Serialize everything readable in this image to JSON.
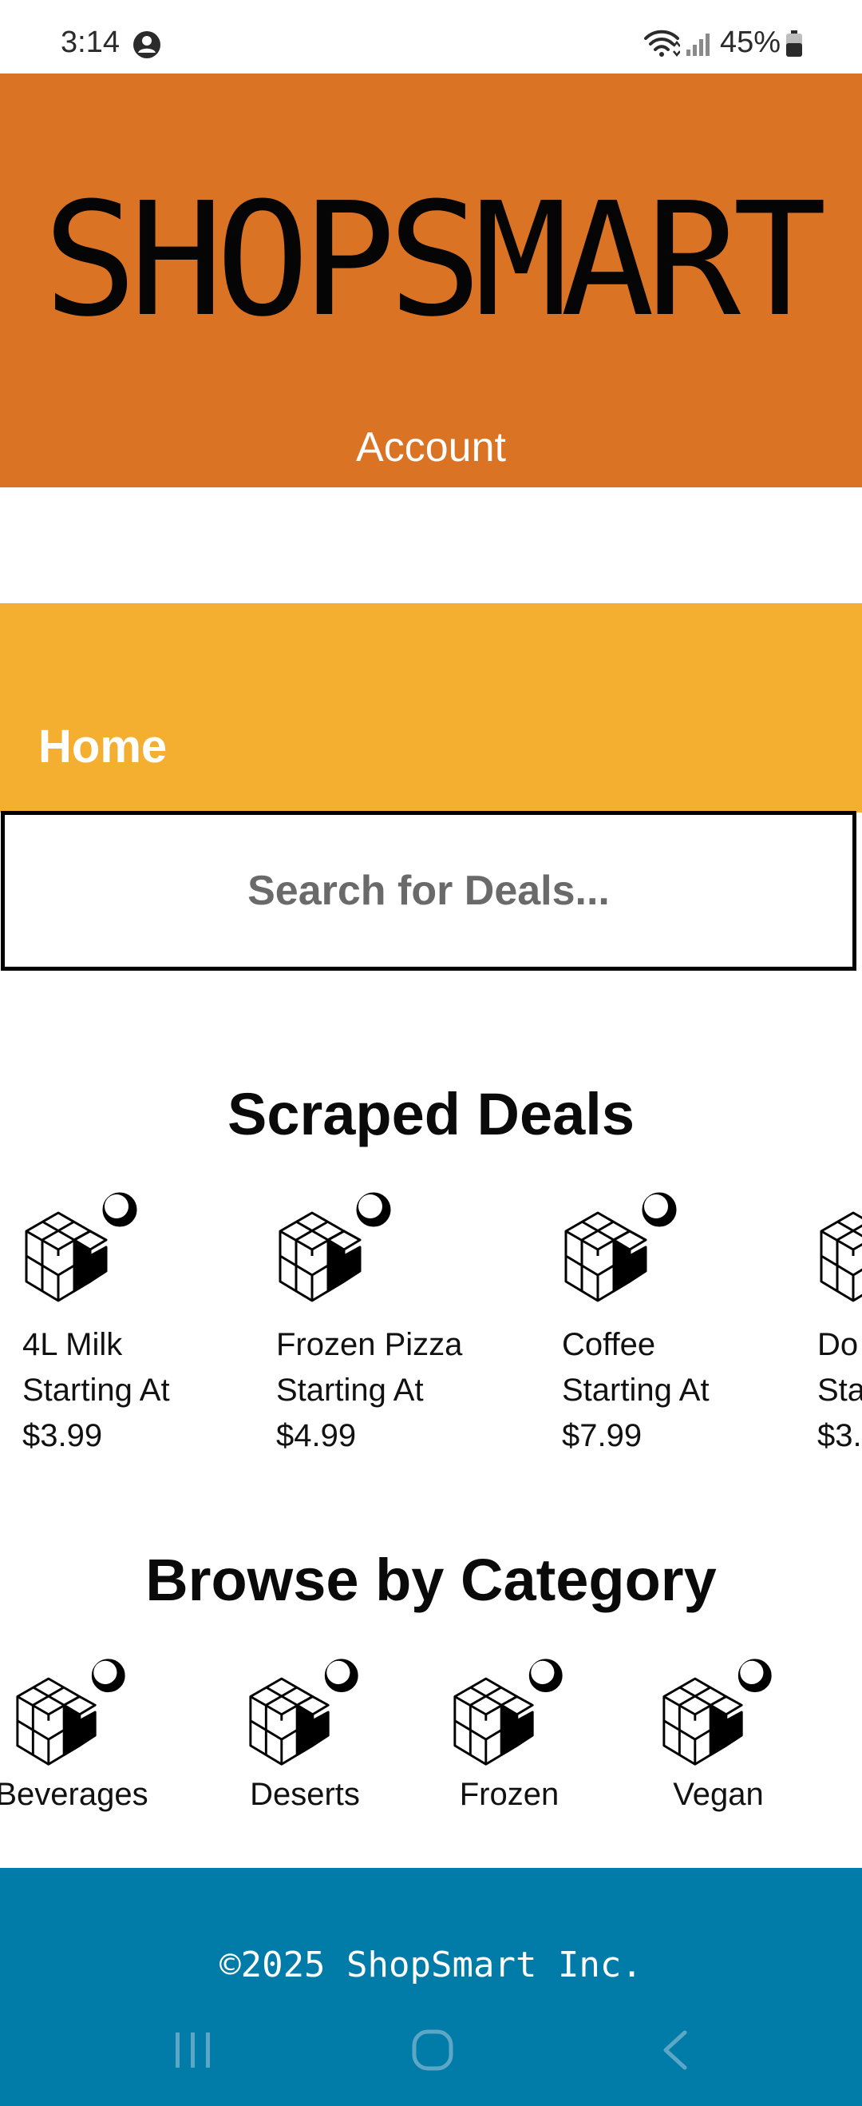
{
  "status_bar": {
    "time": "3:14",
    "battery_percent": "45%",
    "account_icon": "account-circle-icon",
    "wifi_icon": "wifi-icon",
    "signal_icon": "cell-signal-icon",
    "battery_icon": "battery-icon"
  },
  "header": {
    "brand": "SHOPSMART",
    "account_label": "Account",
    "background_color": "#db7324"
  },
  "nav": {
    "home_label": "Home",
    "background_color": "#f4ae30"
  },
  "search": {
    "placeholder": "Search for Deals..."
  },
  "deals_section": {
    "title": "Scraped Deals",
    "items": [
      {
        "name": "4L Milk",
        "prefix": "Starting At",
        "price": "$3.99",
        "icon": "product-cube-icon"
      },
      {
        "name": "Frozen Pizza",
        "prefix": "Starting At",
        "price": "$4.99",
        "icon": "product-cube-icon"
      },
      {
        "name": "Coffee",
        "prefix": "Starting At",
        "price": "$7.99",
        "icon": "product-cube-icon"
      },
      {
        "name": "Do",
        "prefix": "Sta",
        "price": "$3.",
        "icon": "product-cube-icon"
      }
    ]
  },
  "categories_section": {
    "title": "Browse by Category",
    "items": [
      {
        "label": "Beverages",
        "icon": "product-cube-icon"
      },
      {
        "label": "Deserts",
        "icon": "product-cube-icon"
      },
      {
        "label": "Frozen",
        "icon": "product-cube-icon"
      },
      {
        "label": "Vegan",
        "icon": "product-cube-icon"
      }
    ]
  },
  "footer": {
    "copyright": "©2025 ShopSmart Inc.",
    "background_color": "#017ba7"
  },
  "system_nav": {
    "recents_icon": "recents-icon",
    "home_icon": "home-circle-icon",
    "back_icon": "back-icon"
  }
}
